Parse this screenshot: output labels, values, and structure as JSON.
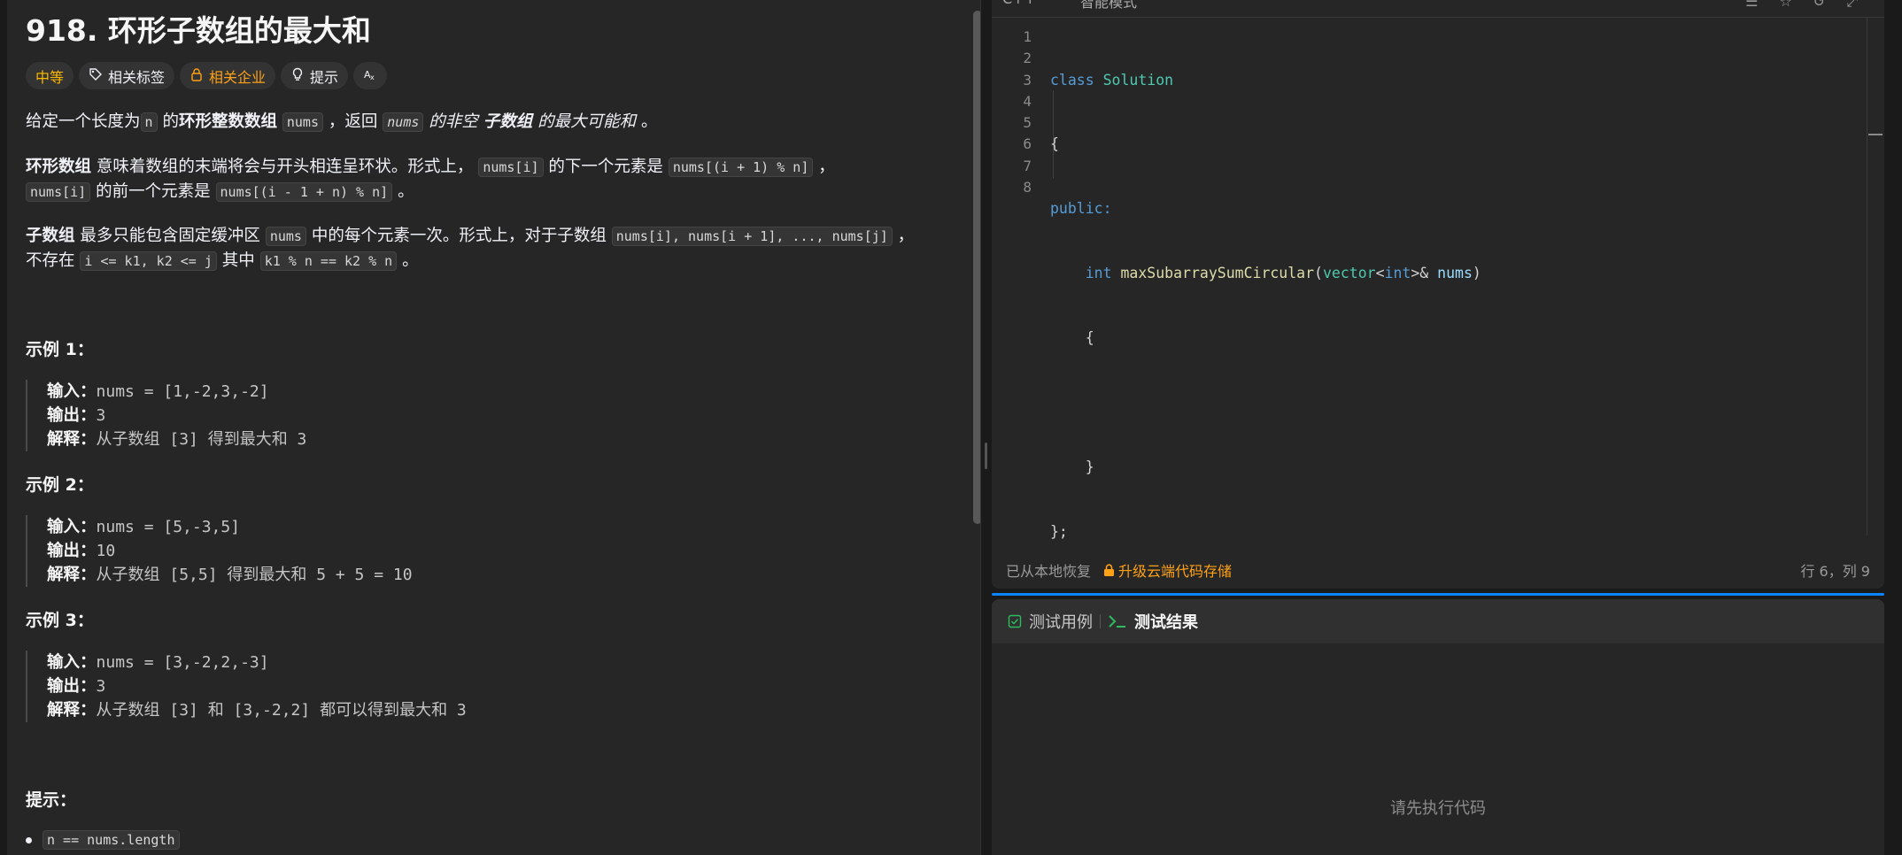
{
  "problem": {
    "title": "918. 环形子数组的最大和",
    "tags": {
      "difficulty": "中等",
      "topics": "相关标签",
      "companies": "相关企业",
      "hint": "提示"
    },
    "p1": {
      "a": "给定一个长度为",
      "code_n": "n",
      "b": "的",
      "bold1": "环形整数数组",
      "code_nums": "nums",
      "c": "，返回",
      "code_nums2": "nums",
      "d": "的非空",
      "bold2": "子数组",
      "e": "的最大可能和",
      "f": "。"
    },
    "p2": {
      "bold": "环形数组",
      "a": "意味着数组的末端将会与开头相连呈环状。形式上，",
      "code1": "nums[i]",
      "b": "的下一个元素是",
      "code2": "nums[(i + 1) % n]",
      "c": "，",
      "code3": "nums[i]",
      "d": "的前一个元素是",
      "code4": "nums[(i - 1 + n) % n]",
      "e": "。"
    },
    "p3": {
      "bold": "子数组",
      "a": "最多只能包含固定缓冲区",
      "code1": "nums",
      "b": "中的每个元素一次。形式上，对于子数组",
      "code2": "nums[i], nums[i + 1], ..., nums[j]",
      "c": "，",
      "d": "不存在",
      "code3": "i <= k1, k2 <= j",
      "e": "其中",
      "code4": "k1 % n == k2 % n",
      "f": "。"
    },
    "examples": [
      {
        "heading": "示例 1：",
        "input_label": "输入：",
        "input": "nums = [1,-2,3,-2]",
        "output_label": "输出：",
        "output": "3",
        "explain_label": "解释：",
        "explain": "从子数组 [3] 得到最大和 3"
      },
      {
        "heading": "示例 2：",
        "input_label": "输入：",
        "input": "nums = [5,-3,5]",
        "output_label": "输出：",
        "output": "10",
        "explain_label": "解释：",
        "explain": "从子数组 [5,5] 得到最大和 5 + 5 = 10"
      },
      {
        "heading": "示例 3：",
        "input_label": "输入：",
        "input": "nums = [3,-2,2,-3]",
        "output_label": "输出：",
        "output": "3",
        "explain_label": "解释：",
        "explain": "从子数组 [3] 和 [3,-2,2] 都可以得到最大和 3"
      }
    ],
    "hints_heading": "提示：",
    "constraint1": "n == nums.length"
  },
  "editor": {
    "language": "C++",
    "mode": "智能模式",
    "line_numbers": [
      "1",
      "2",
      "3",
      "4",
      "5",
      "6",
      "7",
      "8"
    ],
    "code": {
      "l1_kw": "class",
      "l1_name": "Solution",
      "l2": "{",
      "l3": "public:",
      "l4_type": "int",
      "l4_fn": "maxSubarraySumCircular",
      "l4_open": "(",
      "l4_vec": "vector",
      "l4_lt": "<",
      "l4_int": "int",
      "l4_gt": ">& ",
      "l4_param": "nums",
      "l4_close": ")",
      "l5": "{",
      "l7": "}",
      "l8": "};"
    },
    "status": {
      "restored": "已从本地恢复",
      "upgrade": "升级云端代码存储",
      "position": "行 6，列 9"
    }
  },
  "test_panel": {
    "tab_cases": "测试用例",
    "tab_results": "测试结果",
    "empty_message": "请先执行代码"
  },
  "colors": {
    "accent": "#ffa116",
    "difficulty": "#ffb800",
    "divider": "#0a84ff",
    "check": "#2cbb5d"
  }
}
